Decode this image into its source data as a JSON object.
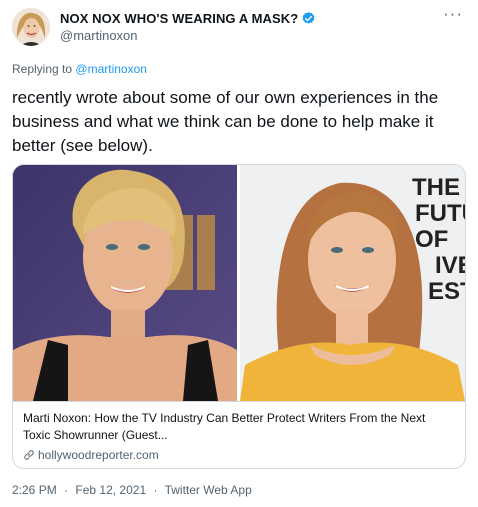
{
  "author": {
    "display_name": "NOX NOX WHO'S WEARING A MASK?",
    "handle": "@martinoxon",
    "verified_icon": "verified-badge-icon"
  },
  "reply": {
    "prefix": "Replying to",
    "handle": "@martinoxon"
  },
  "tweet": {
    "text": "recently wrote about some of our own experiences in the business and what we think can be done to help make it better (see below)."
  },
  "link_card": {
    "title": "Marti Noxon: How the TV Industry Can Better Protect Writers From the Next Toxic Showrunner (Guest...",
    "domain": "hollywoodreporter.com",
    "sign_right_lines": [
      "THE",
      "FUTU",
      "OF",
      "IVE",
      "EST"
    ]
  },
  "meta": {
    "time": "2:26 PM",
    "date": "Feb 12, 2021",
    "source": "Twitter Web App",
    "separator": "·"
  },
  "colors": {
    "accent": "#1d9bf0",
    "text": "#0f1419",
    "secondary": "#536471",
    "border": "#cfd9de"
  }
}
